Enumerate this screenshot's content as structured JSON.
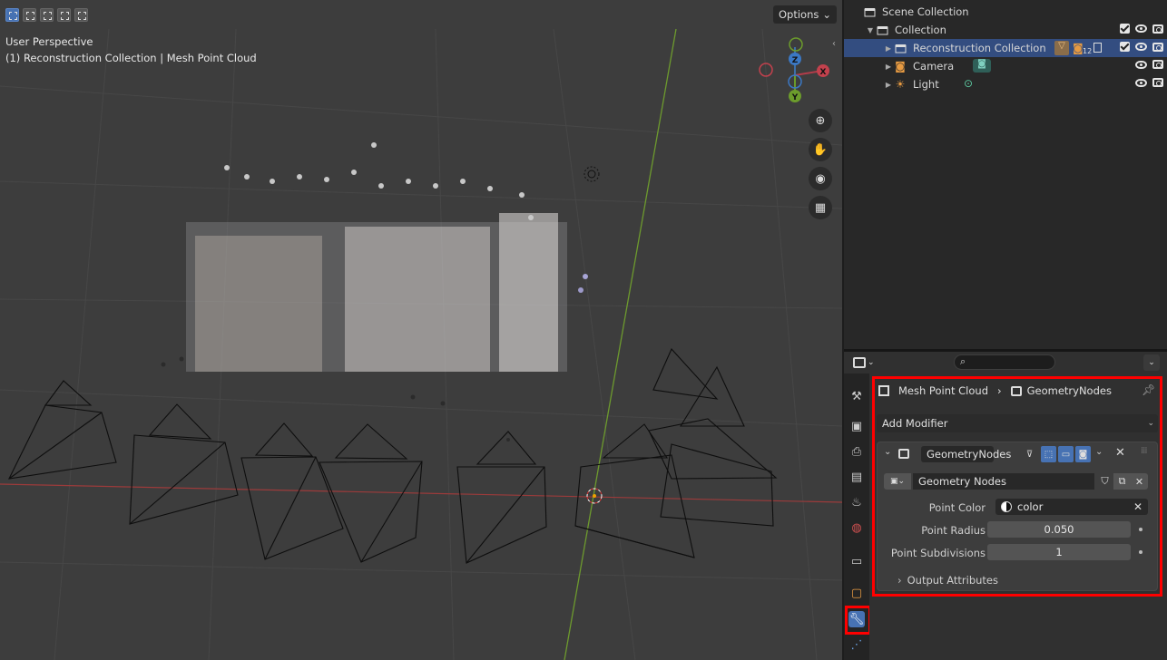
{
  "viewport": {
    "options_label": "Options",
    "view_name": "User Perspective",
    "context": "(1) Reconstruction Collection | Mesh Point Cloud",
    "gizmo": {
      "x": "X",
      "y": "Y",
      "z": "Z"
    },
    "tools": [
      "zoom-icon",
      "hand-pan-icon",
      "camera-view-icon",
      "grid-ortho-icon"
    ]
  },
  "outliner": {
    "rows": [
      {
        "label": "Scene Collection"
      },
      {
        "label": "Collection"
      },
      {
        "label": "Reconstruction Collection",
        "badge": "12"
      },
      {
        "label": "Camera"
      },
      {
        "label": "Light"
      }
    ]
  },
  "properties": {
    "breadcrumb": {
      "object": "Mesh Point Cloud",
      "modifier": "GeometryNodes"
    },
    "add_modifier": "Add Modifier",
    "modifier": {
      "name": "GeometryNodes",
      "node_group": "Geometry Nodes",
      "inputs": [
        {
          "label": "Point Color",
          "value": "color"
        },
        {
          "label": "Point Radius",
          "value": "0.050"
        },
        {
          "label": "Point Subdivisions",
          "value": "1"
        }
      ],
      "output_attributes": "Output Attributes"
    },
    "tabs": [
      "tool-icon",
      "render-icon",
      "output-icon",
      "view-layer-icon",
      "scene-icon",
      "world-icon",
      "collection-icon",
      "object-icon",
      "modifier-wrench-icon",
      "particles-icon"
    ]
  },
  "colors": {
    "highlight": "#ff0000",
    "selected_row": "#334d80",
    "accent": "#4772b3"
  }
}
